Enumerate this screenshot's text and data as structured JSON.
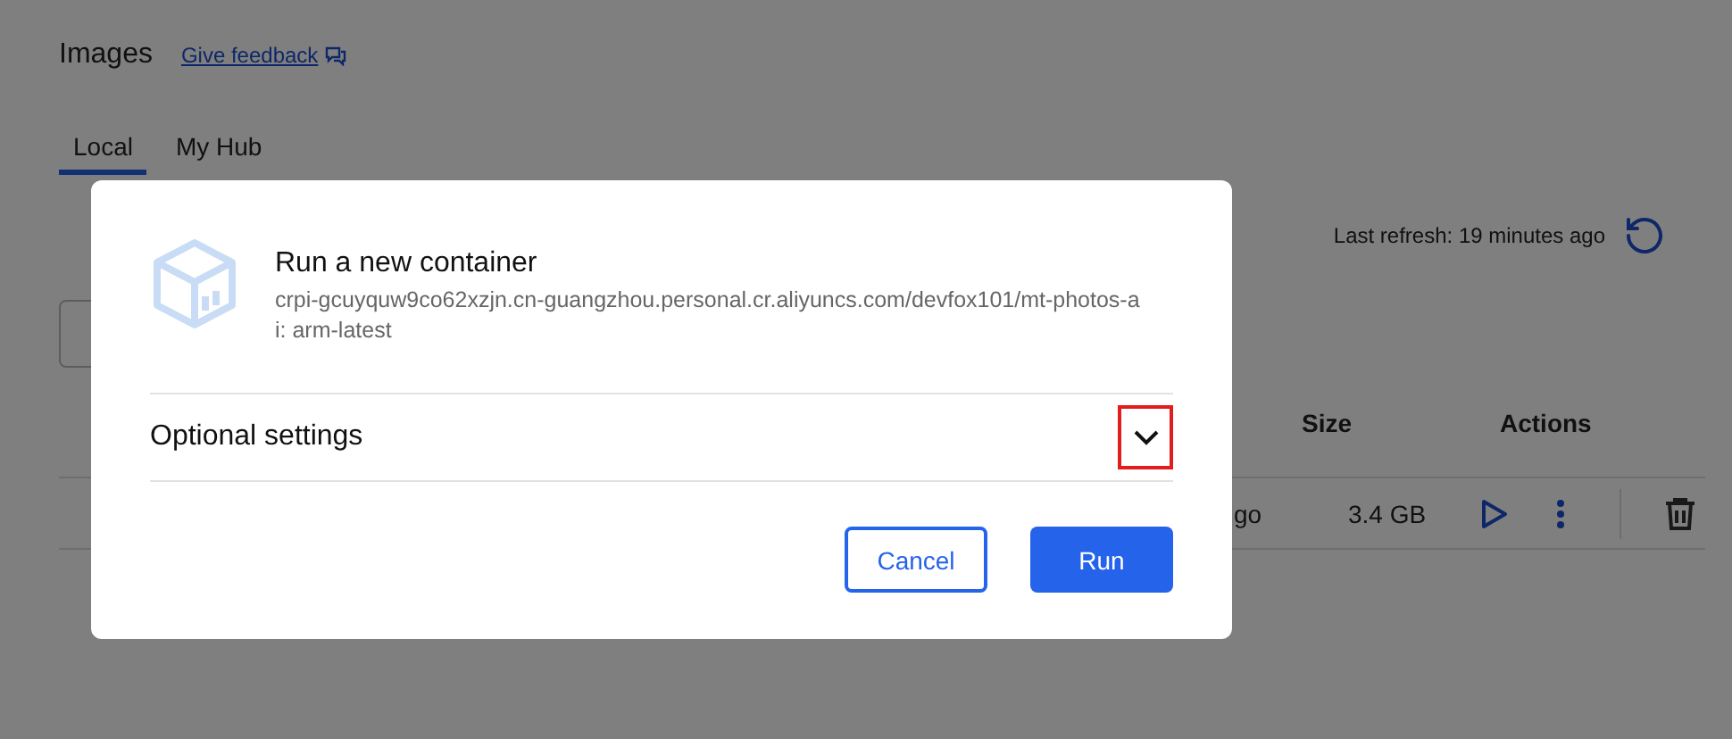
{
  "page": {
    "title": "Images",
    "feedback_link": "Give feedback",
    "tabs": [
      {
        "label": "Local",
        "selected": true
      },
      {
        "label": "My Hub",
        "selected": false
      }
    ],
    "last_refresh": "Last refresh: 19 minutes ago",
    "table": {
      "columns": [
        "Size",
        "Actions"
      ],
      "rows": [
        {
          "column_1": "go",
          "size": "3.4 GB"
        }
      ]
    }
  },
  "dialog": {
    "title": "Run a new container",
    "image": "crpi-gcuyquw9co62xzjn.cn-guangzhou.personal.cr.aliyuncs.com/devfox101/mt-photos-ai: arm-latest",
    "optional_settings": {
      "label": "Optional settings",
      "expanded": false,
      "highlighted": true
    },
    "buttons": [
      {
        "label": "Cancel",
        "kind": "secondary"
      },
      {
        "label": "Run",
        "kind": "primary"
      }
    ]
  }
}
